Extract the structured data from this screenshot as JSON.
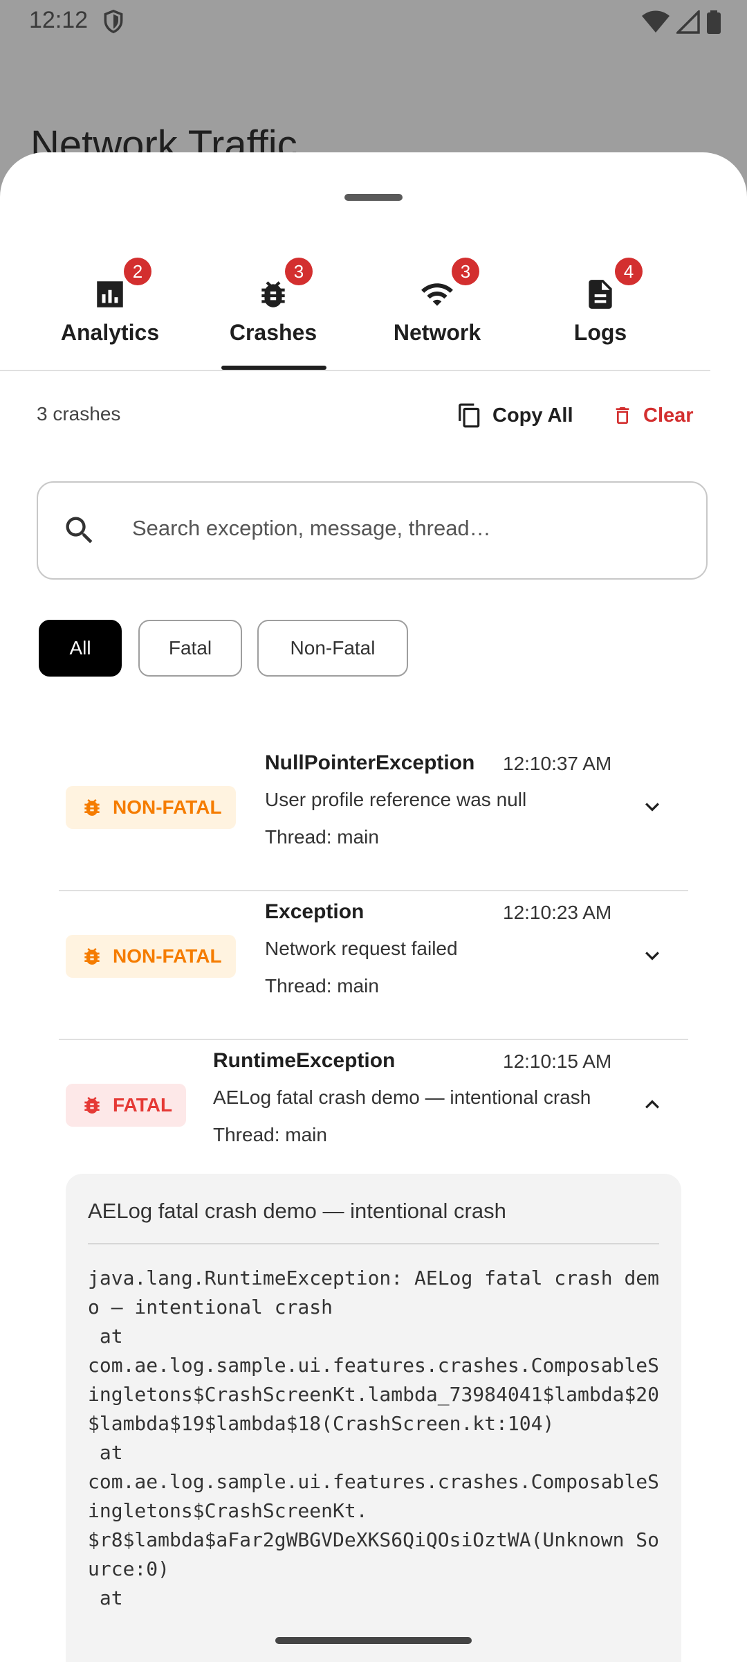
{
  "status_bar": {
    "time": "12:12"
  },
  "background_title": "Network Traffic",
  "tabs": [
    {
      "label": "Analytics",
      "badge": "2",
      "icon": "analytics-icon"
    },
    {
      "label": "Crashes",
      "badge": "3",
      "icon": "bug-icon"
    },
    {
      "label": "Network",
      "badge": "3",
      "icon": "wifi-icon"
    },
    {
      "label": "Logs",
      "badge": "4",
      "icon": "document-icon"
    }
  ],
  "selected_tab": "Crashes",
  "toolbar": {
    "count": "3 crashes",
    "copy_all": "Copy All",
    "clear": "Clear"
  },
  "search": {
    "placeholder": "Search exception, message, thread…"
  },
  "filters": {
    "all": "All",
    "fatal": "Fatal",
    "non_fatal": "Non-Fatal",
    "selected": "All"
  },
  "crashes": [
    {
      "severity": "NON-FATAL",
      "type": "NullPointerException",
      "time": "12:10:37 AM",
      "message": "User profile reference was null",
      "thread": "Thread: main",
      "expanded": false
    },
    {
      "severity": "NON-FATAL",
      "type": "Exception",
      "time": "12:10:23 AM",
      "message": "Network request failed",
      "thread": "Thread: main",
      "expanded": false
    },
    {
      "severity": "FATAL",
      "type": "RuntimeException",
      "time": "12:10:15 AM",
      "message": "AELog fatal crash demo — intentional crash",
      "thread": "Thread: main",
      "expanded": true
    }
  ],
  "detail": {
    "message": "AELog fatal crash demo — intentional crash",
    "stacktrace": "java.lang.RuntimeException: AELog fatal crash demo — intentional crash\n at\ncom.ae.log.sample.ui.features.crashes.ComposableSingletons$CrashScreenKt.lambda_73984041$lambda$20$lambda$19$lambda$18(CrashScreen.kt:104)\n at\ncom.ae.log.sample.ui.features.crashes.ComposableSingletons$CrashScreenKt.\n$r8$lambda$aFar2gWBGVDeXKS6QiQOsiOztWA(Unknown Source:0)\n at"
  },
  "colors": {
    "fatal": "#e53935",
    "non_fatal": "#f57c00",
    "badge": "#d32f2f",
    "clear": "#d32f2f"
  }
}
